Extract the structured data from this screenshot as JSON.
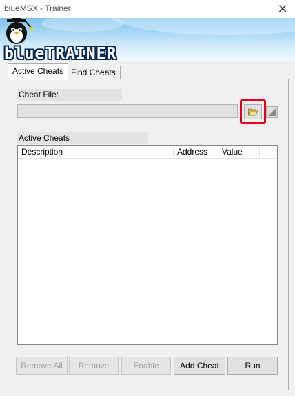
{
  "window": {
    "title": "blueMSX - Trainer",
    "close_glyph": "✕"
  },
  "banner": {
    "logo_text": "blueTRAINER",
    "icon": "penguin-mascot"
  },
  "tabs": [
    {
      "label": "Active Cheats",
      "active": true
    },
    {
      "label": "Find Cheats",
      "active": false
    }
  ],
  "cheat_file": {
    "label": "Cheat File:",
    "value": "",
    "browse_icon": "folder-open-icon",
    "clear_icon": "clear-icon"
  },
  "active_cheats": {
    "label": "Active Cheats",
    "columns": [
      "Description",
      "Address",
      "Value"
    ],
    "rows": []
  },
  "buttons": {
    "remove_all": "Remove All",
    "remove": "Remove",
    "enable": "Enable",
    "add_cheat": "Add Cheat",
    "run": "Run"
  },
  "colors": {
    "highlight": "#e8001c",
    "banner_top": "#7fc2ee",
    "banner_bottom": "#eef8ff"
  }
}
